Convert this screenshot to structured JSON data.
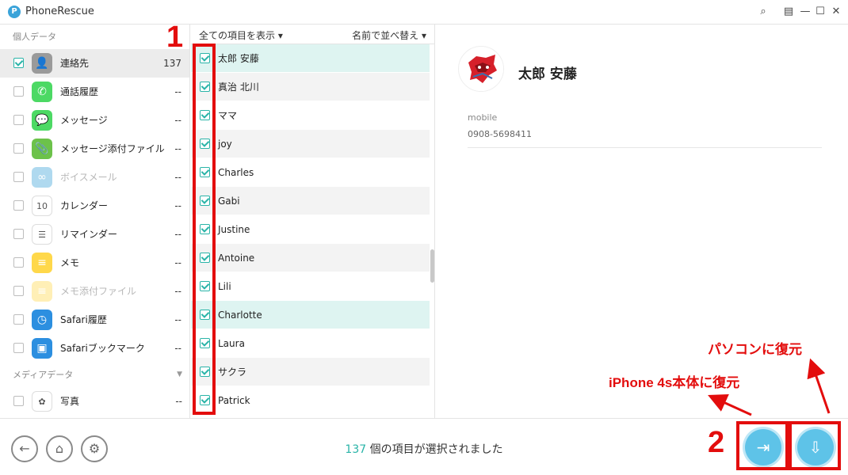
{
  "app": {
    "title": "PhoneRescue",
    "logo_letter": "P"
  },
  "window": {
    "search": "⌕",
    "menu": "▤",
    "minimize": "—",
    "maximize": "☐",
    "close": "✕"
  },
  "sidebar": {
    "section_personal": "個人データ",
    "items": [
      {
        "label": "連絡先",
        "count": "137",
        "checked": true,
        "active": true,
        "icon": "contacts-icon",
        "color": "#9a9a9a",
        "glyph": "👤"
      },
      {
        "label": "通話履歴",
        "count": "--",
        "icon": "phone-icon",
        "color": "#4cd964",
        "glyph": "✆"
      },
      {
        "label": "メッセージ",
        "count": "--",
        "icon": "messages-icon",
        "color": "#4cd964",
        "glyph": "💬"
      },
      {
        "label": "メッセージ添付ファイル",
        "count": "--",
        "icon": "attachment-icon",
        "color": "#6cc24a",
        "glyph": "📎"
      },
      {
        "label": "ボイスメール",
        "count": "--",
        "icon": "voicemail-icon",
        "color": "#3aa3d9",
        "glyph": "∞",
        "disabled": true
      },
      {
        "label": "カレンダー",
        "count": "--",
        "icon": "calendar-icon",
        "color": "#ffffff",
        "glyph": "10"
      },
      {
        "label": "リマインダー",
        "count": "--",
        "icon": "reminders-icon",
        "color": "#ffffff",
        "glyph": "☰"
      },
      {
        "label": "メモ",
        "count": "--",
        "icon": "notes-icon",
        "color": "#ffd84a",
        "glyph": "≡"
      },
      {
        "label": "メモ添付ファイル",
        "count": "--",
        "icon": "notes-attachment-icon",
        "color": "#ffd84a",
        "glyph": "≡",
        "disabled": true
      },
      {
        "label": "Safari履歴",
        "count": "--",
        "icon": "safari-history-icon",
        "color": "#2c8fe0",
        "glyph": "◷"
      },
      {
        "label": "Safariブックマーク",
        "count": "--",
        "icon": "safari-bookmark-icon",
        "color": "#2c8fe0",
        "glyph": "▣"
      }
    ],
    "section_media": "メディアデータ",
    "media_items": [
      {
        "label": "写真",
        "count": "--",
        "icon": "photos-icon",
        "color": "#ffffff",
        "glyph": "✿"
      }
    ]
  },
  "list": {
    "filter_label": "全ての項目を表示 ▾",
    "sort_label": "名前で並べ替え ▾",
    "contacts": [
      "太郎 安藤",
      "真治 北川",
      "ママ",
      "joy",
      "Charles",
      "Gabi",
      "Justine",
      "Antoine",
      "Lili",
      "Charlotte",
      "Laura",
      "サクラ",
      "Patrick"
    ]
  },
  "detail": {
    "name": "太郎 安藤",
    "field_label": "mobile",
    "field_value": "0908-5698411"
  },
  "footer": {
    "back": "←",
    "home": "⌂",
    "settings": "⚙",
    "selected_count": "137",
    "selected_text": " 個の項目が選択されました",
    "restore_device_glyph": "⇥",
    "restore_pc_glyph": "⇩"
  },
  "annotations": {
    "num1": "1",
    "num2": "2",
    "label_device": "iPhone 4s本体に復元",
    "label_pc": "パソコンに復元"
  },
  "colors": {
    "accent": "#2ab4a8",
    "annotation": "#e30d0d",
    "action": "#5ec3e8"
  }
}
